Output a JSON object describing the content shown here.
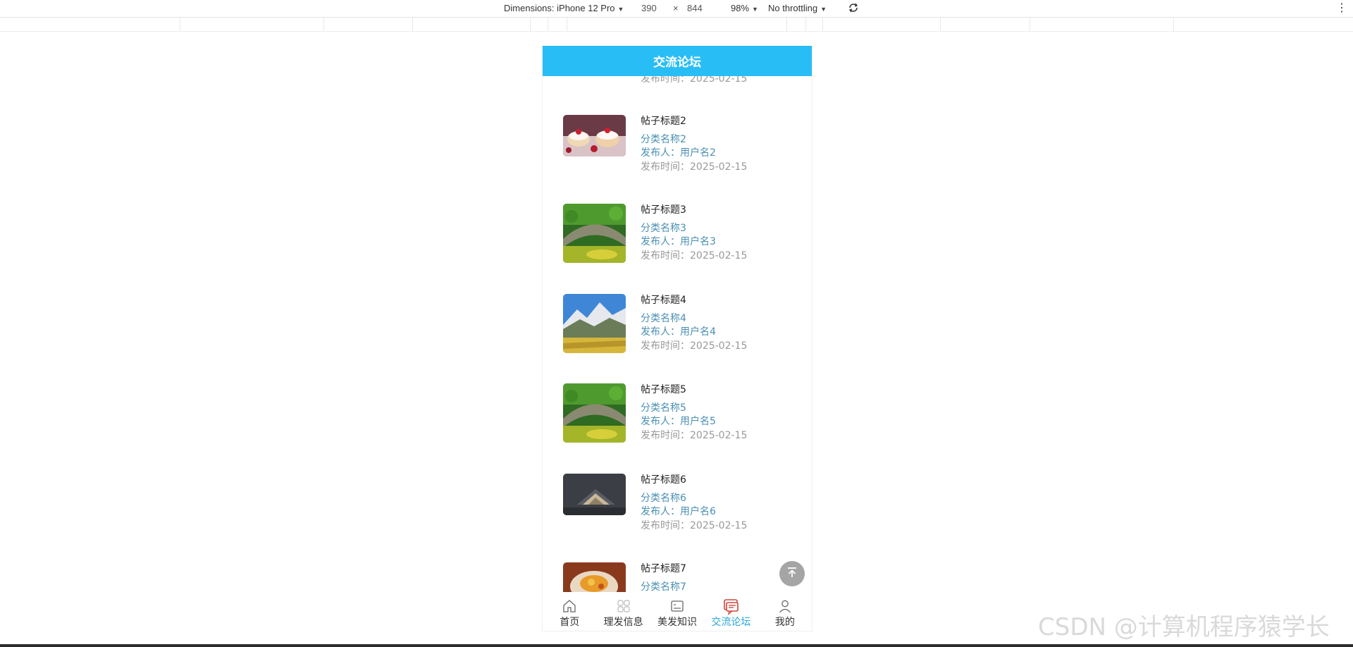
{
  "devtools": {
    "dimensions_label": "Dimensions: iPhone 12 Pro",
    "width": "390",
    "times": "×",
    "height": "844",
    "zoom": "98%",
    "throttling": "No throttling",
    "rotate_icon": "rotate-icon",
    "menu_icon": "more-vertical-icon"
  },
  "app": {
    "header_title": "交流论坛",
    "partial_text": "发布时间：2025-02-15",
    "posts": [
      {
        "title": "帖子标题2",
        "category": "分类名称2",
        "author": "发布人：用户名2",
        "time": "发布时间：2025-02-15",
        "image": "dessert"
      },
      {
        "title": "帖子标题3",
        "category": "分类名称3",
        "author": "发布人：用户名3",
        "time": "发布时间：2025-02-15",
        "image": "stone-bridge"
      },
      {
        "title": "帖子标题4",
        "category": "分类名称4",
        "author": "发布人：用户名4",
        "time": "发布时间：2025-02-15",
        "image": "mountain-landscape"
      },
      {
        "title": "帖子标题5",
        "category": "分类名称5",
        "author": "发布人：用户名5",
        "time": "发布时间：2025-02-15",
        "image": "stone-bridge"
      },
      {
        "title": "帖子标题6",
        "category": "分类名称6",
        "author": "发布人：用户名6",
        "time": "发布时间：2025-02-15",
        "image": "book"
      },
      {
        "title": "帖子标题7",
        "category": "分类名称7",
        "author": "",
        "time": "",
        "image": "food-dish"
      }
    ],
    "back_to_top_icon": "arrow-up-to-top-icon",
    "tabs": [
      {
        "label": "首页",
        "icon": "home-icon",
        "active": false
      },
      {
        "label": "理发信息",
        "icon": "grid-icon",
        "active": false
      },
      {
        "label": "美发知识",
        "icon": "picture-card-icon",
        "active": false
      },
      {
        "label": "交流论坛",
        "icon": "chat-bubble-icon",
        "active": true
      },
      {
        "label": "我的",
        "icon": "user-icon",
        "active": false
      }
    ],
    "colors": {
      "header": "#29bdf5",
      "active_tab": "#29a6d9",
      "link": "#4a8fb3",
      "muted": "#999999"
    }
  },
  "watermark": "CSDN @计算机程序猿学长"
}
